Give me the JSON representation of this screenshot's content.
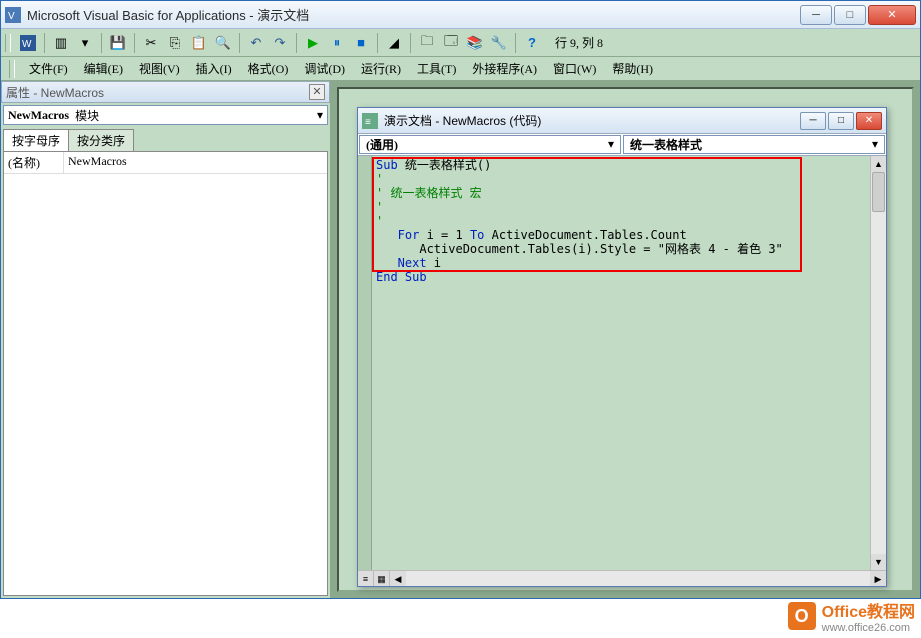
{
  "window": {
    "title": "Microsoft Visual Basic for Applications - 演示文档"
  },
  "toolbar": {
    "status": "行 9, 列 8"
  },
  "menus": [
    "文件(F)",
    "编辑(E)",
    "视图(V)",
    "插入(I)",
    "格式(O)",
    "调试(D)",
    "运行(R)",
    "工具(T)",
    "外接程序(A)",
    "窗口(W)",
    "帮助(H)"
  ],
  "props": {
    "title": "属性 - NewMacros",
    "object_name": "NewMacros",
    "object_type": "模块",
    "tab1": "按字母序",
    "tab2": "按分类序",
    "row_key": "(名称)",
    "row_val": "NewMacros"
  },
  "code_window": {
    "title": "演示文档 - NewMacros (代码)",
    "dd_left": "(通用)",
    "dd_right": "统一表格样式"
  },
  "code": {
    "l1a": "Sub",
    "l1b": " 统一表格样式()",
    "l2": "'",
    "l3": "' 统一表格样式 宏",
    "l4": "'",
    "l5": "'",
    "l6a": "   For",
    "l6b": " i = 1 ",
    "l6c": "To",
    "l6d": " ActiveDocument.Tables.Count",
    "l7": "      ActiveDocument.Tables(i).Style = \"网格表 4 - 着色 3\"",
    "l8a": "   Next",
    "l8b": " i",
    "l9": "End Sub"
  },
  "watermark": {
    "line1": "Office教程网",
    "line2": "www.office26.com"
  }
}
